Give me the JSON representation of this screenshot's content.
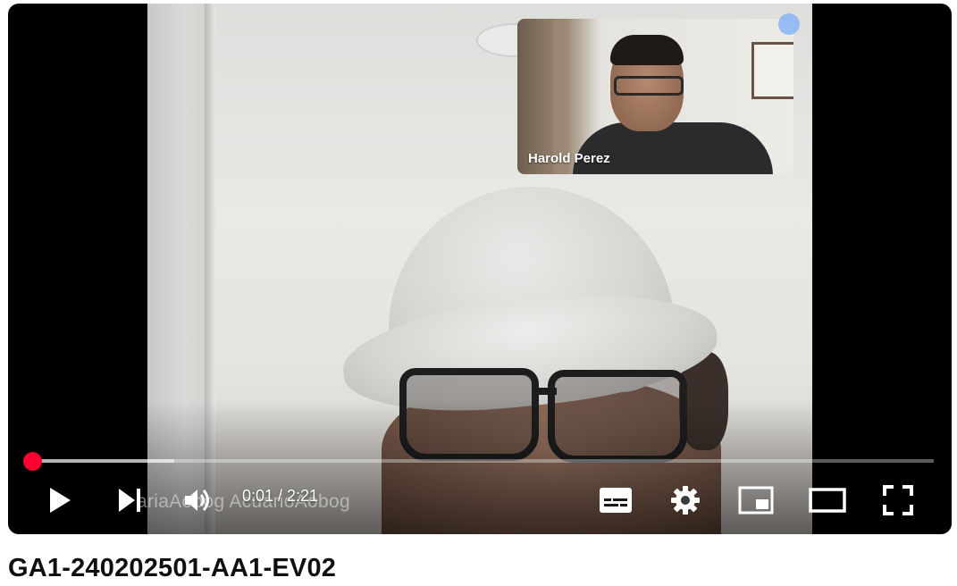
{
  "player": {
    "pip_participant_name": "Harold Perez",
    "watermark_text": "ariaAobog AcuarioAobog",
    "current_time": "0:01",
    "duration": "2:21",
    "time_display": "0:01 / 2:21",
    "progress_played_fraction": 0.0007,
    "progress_loaded_fraction": 0.165,
    "controls": {
      "play": "play-icon",
      "next": "next-icon",
      "volume": "volume-icon",
      "subtitles": "subtitles-icon",
      "settings": "gear-icon",
      "miniplayer": "miniplayer-icon",
      "theater": "theater-mode-icon",
      "fullscreen": "fullscreen-icon"
    },
    "colors": {
      "progress_red": "#ff0000",
      "scrubber_red": "#ff0033",
      "icon_white": "#ffffff"
    }
  },
  "video": {
    "title": "GA1-240202501-AA1-EV02"
  }
}
